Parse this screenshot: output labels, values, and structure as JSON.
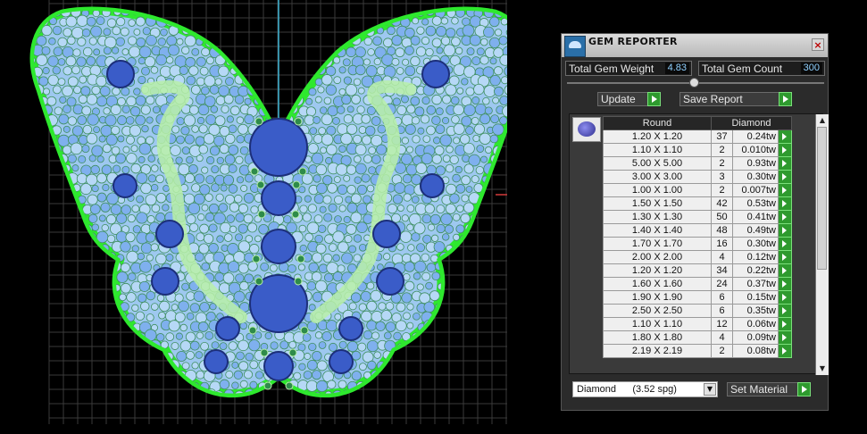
{
  "panel": {
    "title": "GEM REPORTER",
    "close_glyph": "×",
    "total_gem_weight_label": "Total Gem Weight",
    "total_gem_weight_value": "4.83",
    "total_gem_count_label": "Total Gem Count",
    "total_gem_count_value": "300",
    "update_label": "Update",
    "save_report_label": "Save Report",
    "table": {
      "shape_header": "Round",
      "material_header": "Diamond",
      "rows": [
        {
          "size": "1.20 X 1.20",
          "count": "37",
          "weight": "0.24tw"
        },
        {
          "size": "1.10 X 1.10",
          "count": "2",
          "weight": "0.010tw"
        },
        {
          "size": "5.00 X 5.00",
          "count": "2",
          "weight": "0.93tw"
        },
        {
          "size": "3.00 X 3.00",
          "count": "3",
          "weight": "0.30tw"
        },
        {
          "size": "1.00 X 1.00",
          "count": "2",
          "weight": "0.007tw"
        },
        {
          "size": "1.50 X 1.50",
          "count": "42",
          "weight": "0.53tw"
        },
        {
          "size": "1.30 X 1.30",
          "count": "50",
          "weight": "0.41tw"
        },
        {
          "size": "1.40 X 1.40",
          "count": "48",
          "weight": "0.49tw"
        },
        {
          "size": "1.70 X 1.70",
          "count": "16",
          "weight": "0.30tw"
        },
        {
          "size": "2.00 X 2.00",
          "count": "4",
          "weight": "0.12tw"
        },
        {
          "size": "1.20 X 1.20",
          "count": "34",
          "weight": "0.22tw"
        },
        {
          "size": "1.60 X 1.60",
          "count": "24",
          "weight": "0.37tw"
        },
        {
          "size": "1.90 X 1.90",
          "count": "6",
          "weight": "0.15tw"
        },
        {
          "size": "2.50 X 2.50",
          "count": "6",
          "weight": "0.35tw"
        },
        {
          "size": "1.10 X 1.10",
          "count": "12",
          "weight": "0.06tw"
        },
        {
          "size": "1.80 X 1.80",
          "count": "4",
          "weight": "0.09tw"
        },
        {
          "size": "2.19 X 2.19",
          "count": "2",
          "weight": "0.08tw"
        }
      ]
    },
    "material_select_value": "Diamond      (3.52 spg)",
    "set_material_label": "Set Material"
  },
  "icons": {
    "app": "gem-reporter-icon",
    "gem": "round-gem-icon",
    "close": "close-icon",
    "row_action": "play-arrow-icon"
  },
  "colors": {
    "viewport_background": "#000000",
    "grid": "#3a3a3a",
    "butterfly_outline": "#2ee82e",
    "pave_fill": "#9ec8f0",
    "large_stone": "#3a5cc8",
    "channel": "#b8f0a8",
    "panel_background": "#2b2b2b",
    "action_green": "#2e9a2e",
    "value_text": "#8fd0ff"
  }
}
